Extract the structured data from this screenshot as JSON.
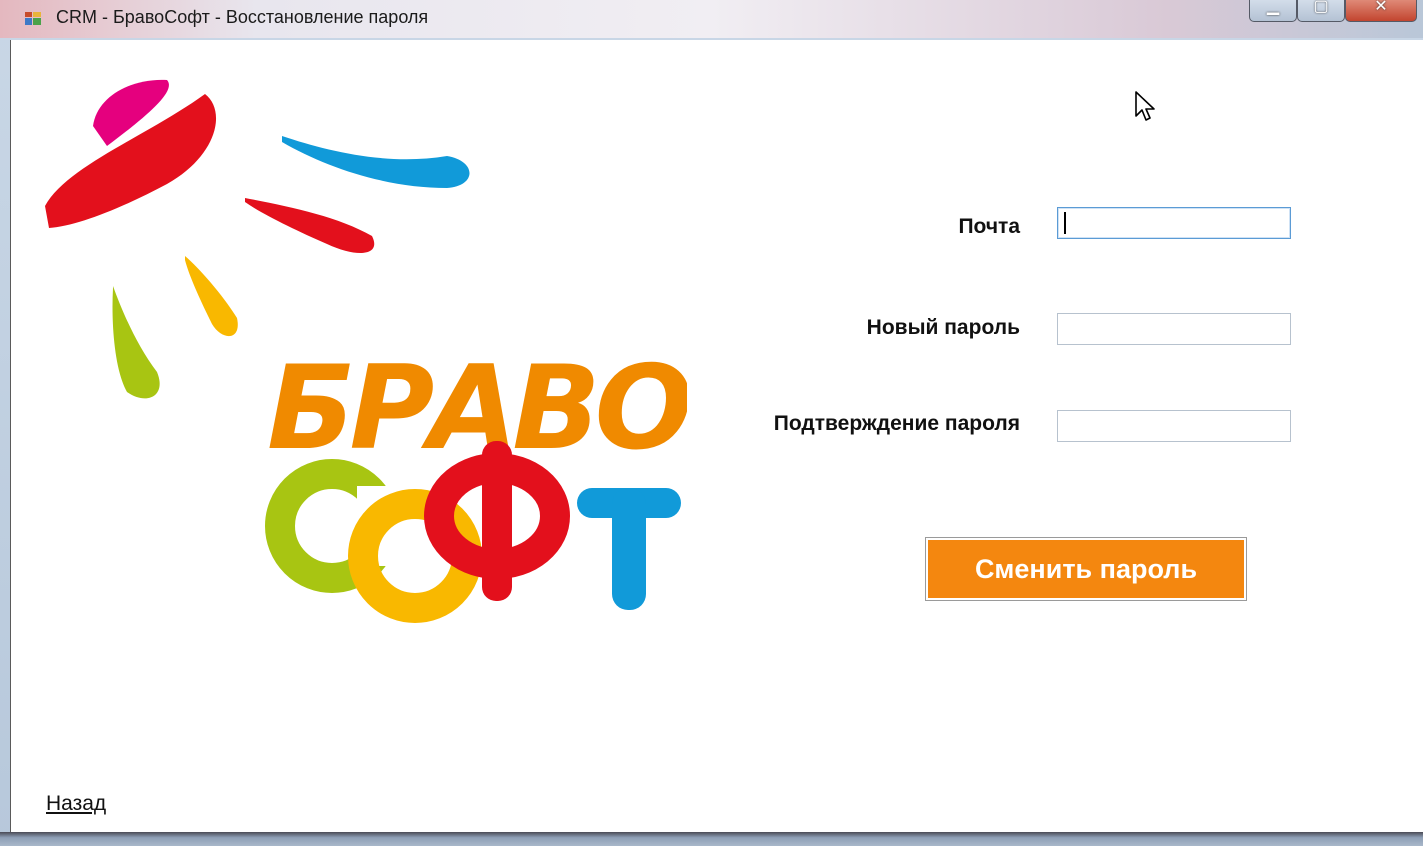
{
  "window": {
    "title": "CRM - БравоСофт - Восстановление пароля",
    "controls": [
      "minimize-icon",
      "maximize-icon",
      "close-icon"
    ]
  },
  "form": {
    "email_label": "Почта",
    "email_value": "",
    "new_password_label": "Новый пароль",
    "new_password_value": "",
    "confirm_password_label": "Подтверждение пароля",
    "confirm_password_value": "",
    "submit_label": "Сменить пароль"
  },
  "footer": {
    "back_link": "Назад"
  },
  "logo": {
    "icon": "bravosoft-logo",
    "text": "БРАВО СОФТ"
  },
  "colors": {
    "accent_orange": "#f4870f",
    "logo_red": "#e3101c",
    "logo_blue": "#119ad9",
    "logo_yellow": "#f9b800",
    "logo_green": "#a8c512",
    "logo_pink": "#e5007e",
    "logo_orange": "#f08a00"
  }
}
